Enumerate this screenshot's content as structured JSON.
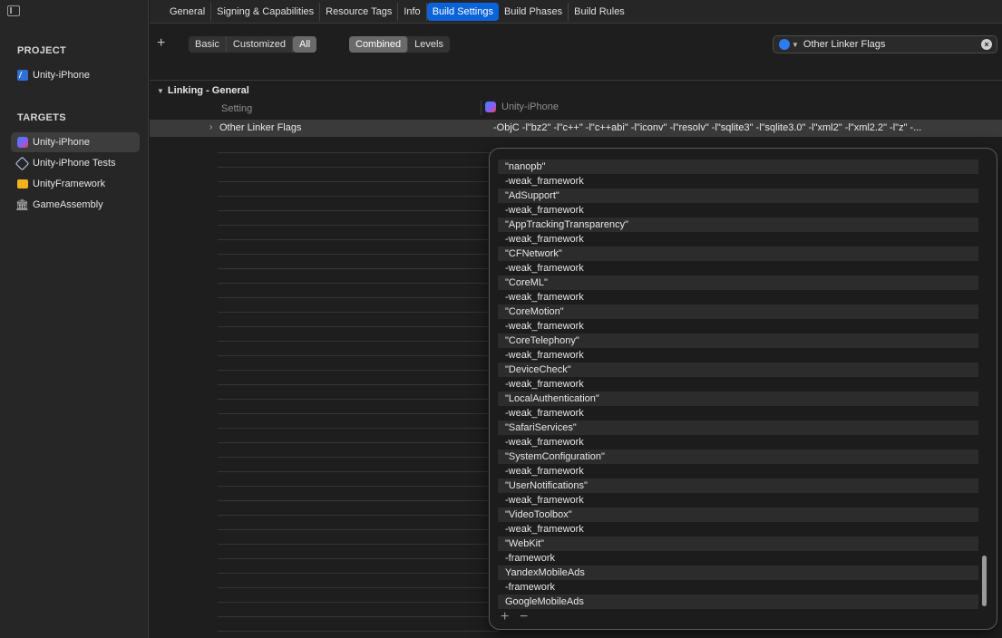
{
  "sidebar": {
    "project_heading": "PROJECT",
    "project_items": [
      {
        "label": "Unity-iPhone",
        "icon": "xcode-project-icon"
      }
    ],
    "targets_heading": "TARGETS",
    "target_items": [
      {
        "label": "Unity-iPhone",
        "icon": "app-icon",
        "selected": true
      },
      {
        "label": "Unity-iPhone Tests",
        "icon": "test-target-icon"
      },
      {
        "label": "UnityFramework",
        "icon": "framework-icon"
      },
      {
        "label": "GameAssembly",
        "icon": "library-icon"
      }
    ]
  },
  "tabs": [
    "General",
    "Signing & Capabilities",
    "Resource Tags",
    "Info",
    "Build Settings",
    "Build Phases",
    "Build Rules"
  ],
  "active_tab": "Build Settings",
  "filter": {
    "scope": [
      "Basic",
      "Customized",
      "All"
    ],
    "scope_selected": "All",
    "view": [
      "Combined",
      "Levels"
    ],
    "view_selected": "Combined",
    "search_value": "Other Linker Flags"
  },
  "section": {
    "title": "Linking - General",
    "col_setting": "Setting",
    "col_target": "Unity-iPhone"
  },
  "setting": {
    "name": "Other Linker Flags",
    "value": "-ObjC -l\"bz2\" -l\"c++\" -l\"c++abi\" -l\"iconv\" -l\"resolv\" -l\"sqlite3\" -l\"sqlite3.0\" -l\"xml2\" -l\"xml2.2\" -l\"z\" -..."
  },
  "popover_items": [
    "\"nanopb\"",
    "-weak_framework",
    "\"AdSupport\"",
    "-weak_framework",
    "\"AppTrackingTransparency\"",
    "-weak_framework",
    "\"CFNetwork\"",
    "-weak_framework",
    "\"CoreML\"",
    "-weak_framework",
    "\"CoreMotion\"",
    "-weak_framework",
    "\"CoreTelephony\"",
    "-weak_framework",
    "\"DeviceCheck\"",
    "-weak_framework",
    "\"LocalAuthentication\"",
    "-weak_framework",
    "\"SafariServices\"",
    "-weak_framework",
    "\"SystemConfiguration\"",
    "-weak_framework",
    "\"UserNotifications\"",
    "-weak_framework",
    "\"VideoToolbox\"",
    "-weak_framework",
    "\"WebKit\"",
    "-framework",
    "YandexMobileAds",
    "-framework",
    "GoogleMobileAds"
  ],
  "colors": {
    "accent": "#0a63d9",
    "background": "#1e1e1e",
    "sidebar": "#262626"
  }
}
